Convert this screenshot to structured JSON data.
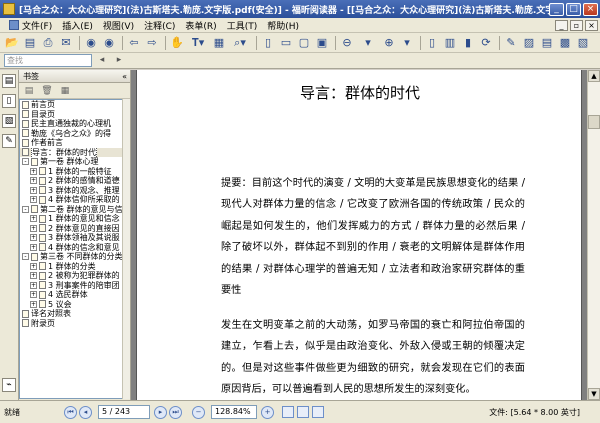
{
  "window": {
    "title": "[马合之众：大众心理研究](法)古斯塔夫.勒庞.文字版.pdf(安全)] - 福昕阅读器 - [[马合之众：大众心理研究](法)古斯塔夫.勒庞.文字版.pdf(安全)]"
  },
  "menu": {
    "items": [
      {
        "label": "文件(F)"
      },
      {
        "label": "插入(E)"
      },
      {
        "label": "视图(V)"
      },
      {
        "label": "注释(C)"
      },
      {
        "label": "表单(R)"
      },
      {
        "label": "工具(T)"
      },
      {
        "label": "帮助(H)"
      }
    ]
  },
  "search": {
    "placeholder": "查找"
  },
  "panel": {
    "title": "书签",
    "bookmarks": [
      {
        "label": "前言页",
        "level": 0,
        "expand": ""
      },
      {
        "label": "目录页",
        "level": 0,
        "expand": ""
      },
      {
        "label": "民主直通独裁的心理机",
        "level": 0,
        "expand": ""
      },
      {
        "label": "勒庞《乌合之众》的得",
        "level": 0,
        "expand": ""
      },
      {
        "label": "作者前言",
        "level": 0,
        "expand": ""
      },
      {
        "label": "导言：群体的时代",
        "level": 0,
        "expand": "",
        "selected": true
      },
      {
        "label": "第一卷 群体心理",
        "level": 0,
        "expand": "-"
      },
      {
        "label": "1 群体的一般特征",
        "level": 1,
        "expand": "+"
      },
      {
        "label": "2 群体的感情和道德",
        "level": 1,
        "expand": "+"
      },
      {
        "label": "3 群体的观念、推理",
        "level": 1,
        "expand": "+"
      },
      {
        "label": "4 群体信仰所采取的",
        "level": 1,
        "expand": "+"
      },
      {
        "label": "第二卷 群体的意见与信",
        "level": 0,
        "expand": "-"
      },
      {
        "label": "1 群体的意见和信念",
        "level": 1,
        "expand": "+"
      },
      {
        "label": "2 群体意见的直接因",
        "level": 1,
        "expand": "+"
      },
      {
        "label": "3 群体领袖及其说服",
        "level": 1,
        "expand": "+"
      },
      {
        "label": "4 群体的信念和意见",
        "level": 1,
        "expand": "+"
      },
      {
        "label": "第三卷 不同群体的分类",
        "level": 0,
        "expand": "-"
      },
      {
        "label": "1 群体的分类",
        "level": 1,
        "expand": "+"
      },
      {
        "label": "2 被称为犯罪群体的",
        "level": 1,
        "expand": "+"
      },
      {
        "label": "3 刑事案件的陪审团",
        "level": 1,
        "expand": "+"
      },
      {
        "label": "4 选民群体",
        "level": 1,
        "expand": "+"
      },
      {
        "label": "5 议会",
        "level": 1,
        "expand": "+"
      },
      {
        "label": "译名对照表",
        "level": 0,
        "expand": ""
      },
      {
        "label": "附录页",
        "level": 0,
        "expand": ""
      }
    ]
  },
  "document": {
    "title": "导言：群体的时代",
    "paragraph1": "提要：目前这个时代的演变 / 文明的大变革是民族思想变化的结果 / 现代人对群体力量的信念 / 它改变了欧洲各国的传统政策 / 民众的崛起是如何发生的，他们发挥威力的方式 / 群体力量的必然后果 / 除了破坏以外，群体起不到别的作用 / 衰老的文明解体是群体作用的结果 / 对群体心理学的普遍无知 / 立法者和政治家研究群体的重要性",
    "paragraph2": "发生在文明变革之前的大动荡，如罗马帝国的衰亡和阿拉伯帝国的建立，乍看上去，似乎是由政治变化、外敌入侵或王朝的倾覆决定的。但是对这些事件做些更为细致的研究，就会发现在它们的表面原因背后，可以普遍看到人民的思想所发生的深刻变化。"
  },
  "status": {
    "ready": "就绪",
    "page": "5 / 243",
    "zoom": "128.84%",
    "docsize": "文件: [5.64 * 8.00 英寸]"
  }
}
